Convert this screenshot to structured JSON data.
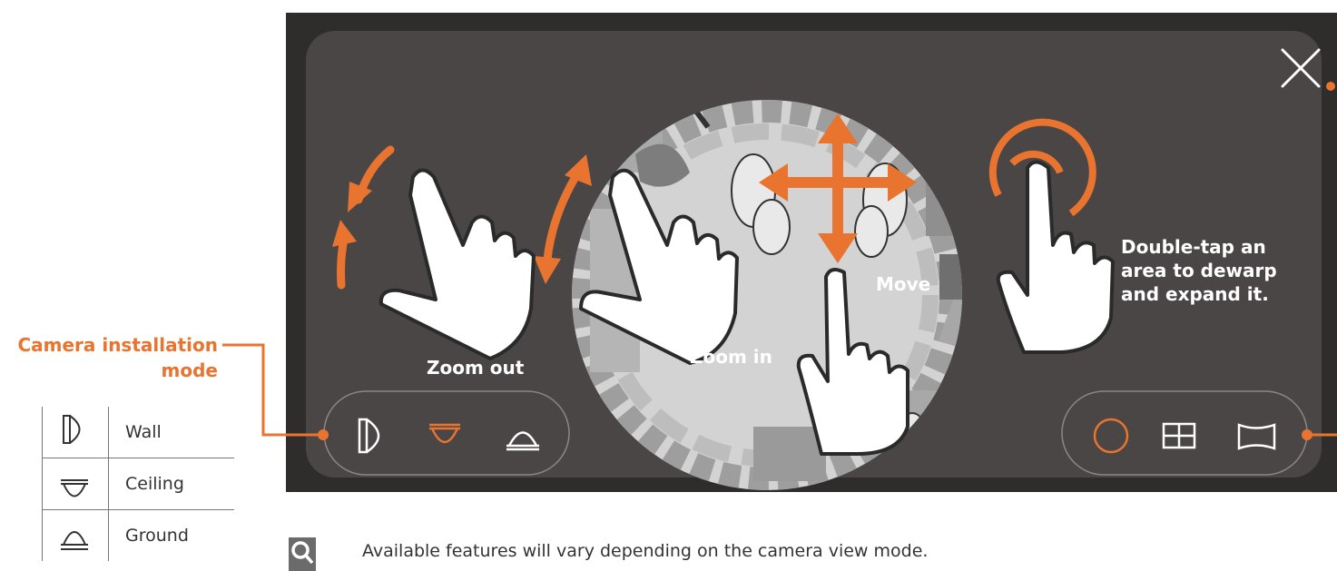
{
  "gestures": {
    "zoom_out": "Zoom out",
    "zoom_in": "Zoom in",
    "move": "Move",
    "double_tap_line1": "Double-tap an",
    "double_tap_line2": "area to dewarp",
    "double_tap_line3": "and expand it."
  },
  "install_mode": {
    "title_line1": "Camera installation",
    "title_line2": "mode",
    "buttons": [
      {
        "icon": "wall-mount-icon",
        "selected": false
      },
      {
        "icon": "ceiling-mount-icon",
        "selected": true
      },
      {
        "icon": "ground-mount-icon",
        "selected": false
      }
    ]
  },
  "view_mode": {
    "buttons": [
      {
        "icon": "fisheye-circle-icon",
        "selected": true
      },
      {
        "icon": "quad-view-icon",
        "selected": false
      },
      {
        "icon": "panorama-view-icon",
        "selected": false
      }
    ]
  },
  "legend": [
    {
      "icon": "wall-mount-icon",
      "label": "Wall"
    },
    {
      "icon": "ceiling-mount-icon",
      "label": "Ceiling"
    },
    {
      "icon": "ground-mount-icon",
      "label": "Ground"
    }
  ],
  "note": "Available features will vary depending on the camera view mode.",
  "colors": {
    "accent": "#e8742f",
    "frame": "#2f2c2c",
    "panel": "#4a4646",
    "fisheye": "#c9c9c9"
  }
}
